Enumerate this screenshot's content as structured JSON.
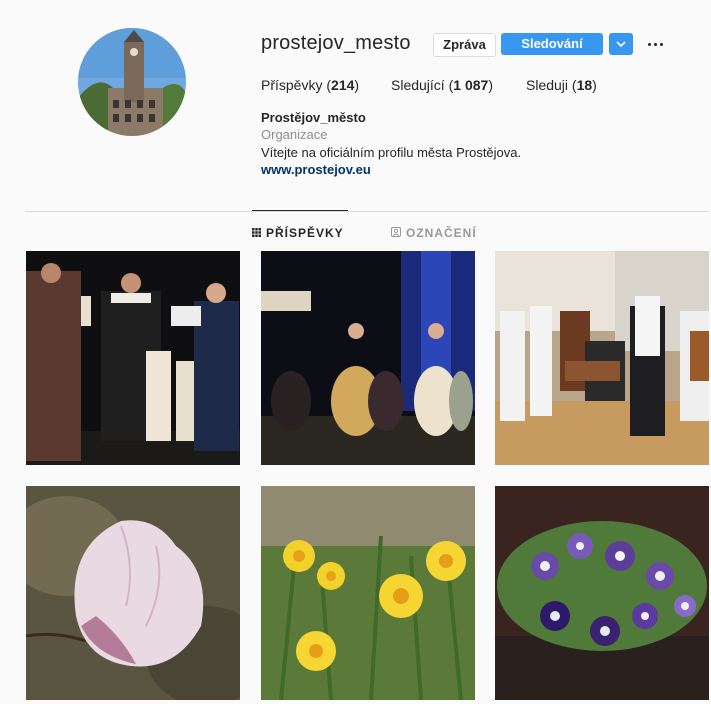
{
  "profile": {
    "username": "prostejov_mesto",
    "message_button": "Zpráva",
    "follow_button": "Sledování"
  },
  "stats": [
    {
      "label": "Příspěvky",
      "value": "214"
    },
    {
      "label": "Sledující",
      "value": "1 087"
    },
    {
      "label": "Sleduji",
      "value": "18"
    }
  ],
  "bio": {
    "name": "Prostějov_město",
    "category": "Organizace",
    "text": "Vítejte na oficiálním profilu města Prostějova.",
    "link": "www.prostejov.eu"
  },
  "tabs": [
    {
      "label": "PŘÍSPĚVKY",
      "active": true,
      "icon": "grid-icon"
    },
    {
      "label": "OZNAČENÍ",
      "active": false,
      "icon": "tag-user-icon"
    }
  ],
  "colors": {
    "follow_blue": "#3897f0",
    "link_color": "#003569",
    "muted": "#8e8e8e"
  },
  "posts": [
    {
      "subject": "renaissance-costumes-stage-1"
    },
    {
      "subject": "renaissance-dance-stage-2"
    },
    {
      "subject": "folk-music-band"
    },
    {
      "subject": "magnolia-flower"
    },
    {
      "subject": "daffodils"
    },
    {
      "subject": "pansies-in-pot"
    }
  ]
}
